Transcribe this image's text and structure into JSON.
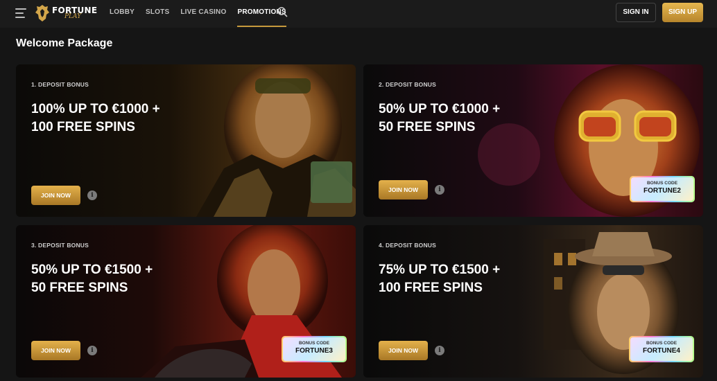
{
  "header": {
    "logo": {
      "line1": "FORTUNE",
      "line2": "PLAY"
    },
    "nav": [
      {
        "label": "LOBBY"
      },
      {
        "label": "SLOTS"
      },
      {
        "label": "LIVE CASINO"
      },
      {
        "label": "PROMOTIONS",
        "active": true
      }
    ],
    "sign_in": "SIGN IN",
    "sign_up": "SIGN UP"
  },
  "section_title": "Welcome Package",
  "cards": [
    {
      "eyebrow": "1. DEPOSIT BONUS",
      "line1": "100% UP TO €1000 +",
      "line2": "100 FREE SPINS",
      "join": "JOIN NOW",
      "info": "i"
    },
    {
      "eyebrow": "2. DEPOSIT BONUS",
      "line1": "50% UP TO €1000 +",
      "line2": "50 FREE SPINS",
      "join": "JOIN NOW",
      "info": "i",
      "bonus_label": "BONUS CODE",
      "bonus_code": "FORTUNE2"
    },
    {
      "eyebrow": "3. DEPOSIT BONUS",
      "line1": "50% UP TO €1500 +",
      "line2": "50 FREE SPINS",
      "join": "JOIN NOW",
      "info": "i",
      "bonus_label": "BONUS CODE",
      "bonus_code": "FORTUNE3"
    },
    {
      "eyebrow": "4. DEPOSIT BONUS",
      "line1": "75% UP TO €1500 +",
      "line2": "100 FREE SPINS",
      "join": "JOIN NOW",
      "info": "i",
      "bonus_label": "BONUS CODE",
      "bonus_code": "FORTUNE4"
    }
  ],
  "colors": {
    "accent": "#c69a3c",
    "header_bg": "#1b1b1b",
    "page_bg": "#151515"
  }
}
